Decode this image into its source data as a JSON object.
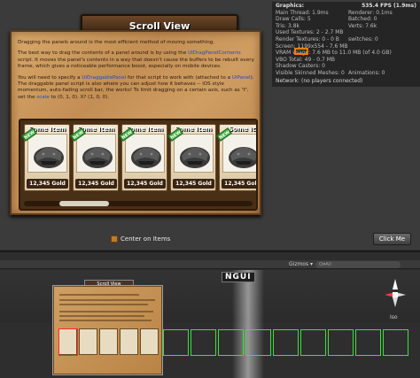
{
  "window": {
    "title": "Scroll View"
  },
  "description": {
    "p1": "Dragging the panels around is the most efficient method of moving something.",
    "p2a": "The best way to drag the contents of a panel around is by using the ",
    "p2link": "UIDragPanelContents",
    "p2b": " script. It moves the panel's contents in a way that doesn't cause the buffers to be rebuilt every frame, which gives a noticeable performance boost, especially on mobile devices.",
    "p3a": "You will need to specify a ",
    "p3link1": "UIDraggablePanel",
    "p3b": " for that script to work with (attached to a ",
    "p3link2": "UIPanel",
    "p3c": "). The draggable panel script is also where you can adjust how it behaves -- iOS style momentum, auto-fading scroll bar, the works! To limit dragging on a certain axis, such as 'Y', set the ",
    "p3link3": "scale",
    "p3d": " to (0, 1, 0). X? (1, 0, 0)."
  },
  "items": [
    {
      "name": "Some Item",
      "price": "12,345 Gold",
      "badge": "NEW"
    },
    {
      "name": "Some Item",
      "price": "12,345 Gold",
      "badge": "NEW"
    },
    {
      "name": "Some Item",
      "price": "12,345 Gold",
      "badge": "NEW"
    },
    {
      "name": "Some Item",
      "price": "12,345 Gold",
      "badge": "NEW"
    },
    {
      "name": "Some It",
      "price": "12,345 Gold",
      "badge": "NEW"
    }
  ],
  "scroll": {
    "position_fraction": 0.2
  },
  "controls": {
    "center_on_items": "Center on Items",
    "click_me": "Click Me"
  },
  "stats": {
    "header": "Graphics:",
    "fps": "535.4 FPS (1.9ms)",
    "rows": [
      [
        "Main Thread: 1.9ms",
        "Renderer: 0.1ms"
      ],
      [
        "Draw Calls: 5",
        "Batched: 0"
      ],
      [
        "Tris: 3.8k",
        "Verts: 7.6k"
      ],
      [
        "Used Textures: 2 - 2.7 MB",
        ""
      ],
      [
        "Render Textures: 0 - 0 B",
        "switches: 0"
      ],
      [
        "Screen: 1199x554 - 7.6 MB",
        ""
      ],
      [
        "VRAM usage: 7.6 MB to 11.0 MB (of 4.0 GB)",
        ""
      ],
      [
        "VBO Total: 49 - 0.7 MB",
        ""
      ],
      [
        "Shadow Casters: 0",
        ""
      ],
      [
        "Visible Skinned Meshes: 0",
        "Animations: 0"
      ]
    ],
    "network": "Network: (no players connected)"
  },
  "scene": {
    "gizmos_label": "Gizmos ▾",
    "search_placeholder": "Q▾All",
    "logo": "NGUI",
    "mini_title": "Scroll View",
    "projection": "Iso"
  },
  "colors": {
    "accent": "#ff7a00",
    "link": "#1f4fb8",
    "selection": "#ff2a2a",
    "grid": "#3ee03e"
  }
}
